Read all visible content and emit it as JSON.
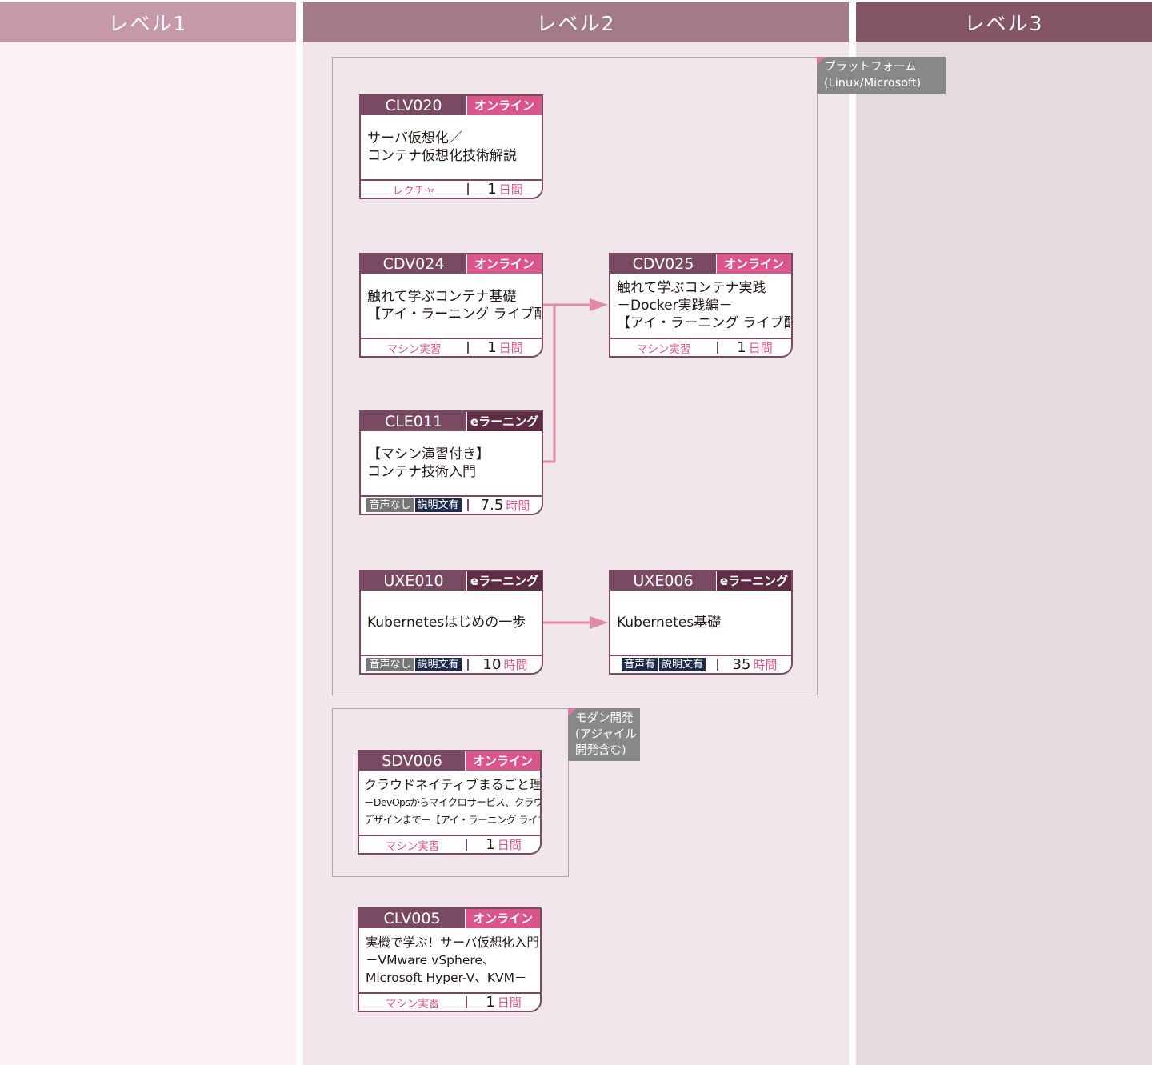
{
  "columns": {
    "level1": {
      "label": "レベル1",
      "color": "#c599aa"
    },
    "level2": {
      "label": "レベル2",
      "color": "#a27a8a"
    },
    "level3": {
      "label": "レベル3",
      "color": "#845467"
    }
  },
  "groups": {
    "platform": {
      "label_lines": [
        "プラットフォーム",
        "(Linux/Microsoft)"
      ]
    },
    "modern": {
      "label_lines": [
        "モダン開発",
        "(アジャイル",
        "開発含む)"
      ]
    }
  },
  "courses": {
    "clv020": {
      "code": "CLV020",
      "type": "オンライン",
      "title_lines": [
        "サーバ仮想化／",
        "コンテナ仮想化技術解説"
      ],
      "method": "レクチャ",
      "duration": "1",
      "unit": "日間"
    },
    "cdv024": {
      "code": "CDV024",
      "type": "オンライン",
      "title_lines": [
        "触れて学ぶコンテナ基礎",
        "【アイ・ラーニング ライブ配信】"
      ],
      "method": "マシン実習",
      "duration": "1",
      "unit": "日間"
    },
    "cdv025": {
      "code": "CDV025",
      "type": "オンライン",
      "title_lines": [
        "触れて学ぶコンテナ実践",
        "－Docker実践編－",
        "【アイ・ラーニング ライブ配信】"
      ],
      "method": "マシン実習",
      "duration": "1",
      "unit": "日間"
    },
    "cle011": {
      "code": "CLE011",
      "type": "eラーニング",
      "title_lines": [
        "【マシン演習付き】",
        "コンテナ技術入門"
      ],
      "tag1": "音声なし",
      "tag2": "説明文有",
      "duration": "7.5",
      "unit": "時間"
    },
    "uxe010": {
      "code": "UXE010",
      "type": "eラーニング",
      "title_lines": [
        "Kubernetesはじめの一歩"
      ],
      "tag1": "音声なし",
      "tag2": "説明文有",
      "duration": "10",
      "unit": "時間"
    },
    "uxe006": {
      "code": "UXE006",
      "type": "eラーニング",
      "title_lines": [
        "Kubernetes基礎"
      ],
      "tag1": "音声有",
      "tag2": "説明文有",
      "duration": "35",
      "unit": "時間"
    },
    "sdv006": {
      "code": "SDV006",
      "type": "オンライン",
      "title_lines": [
        "クラウドネイティブまるごと理解",
        "－DevOpsからマイクロサービス、クラウド",
        "デザインまで－【アイ・ラーニング ライブ配信】"
      ],
      "method": "マシン実習",
      "duration": "1",
      "unit": "日間"
    },
    "clv005": {
      "code": "CLV005",
      "type": "オンライン",
      "title_lines": [
        "実機で学ぶ！サーバ仮想化入門",
        "－VMware vSphere、",
        "Microsoft Hyper-V、KVM－"
      ],
      "method": "マシン実習",
      "duration": "1",
      "unit": "日間"
    }
  },
  "colors": {
    "accent": "#d9558a",
    "card_border": "#7a4a62",
    "arrow": "#e08aa8"
  }
}
